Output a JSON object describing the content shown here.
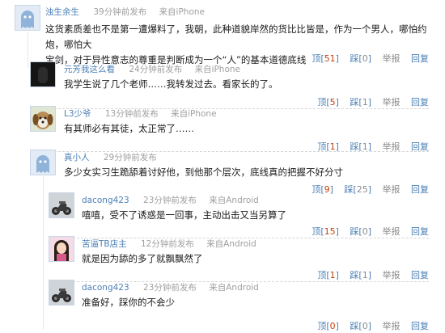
{
  "comments": [
    {
      "user": "浊生余生",
      "time": "39分钟前发布",
      "source": "来自iPhone",
      "text_lines": [
        "这货素质差也不是第一遭爆料了，我朝，此种道貌岸然的货比比皆是，作为一个男人，哪怕约炮，哪怕大",
        "宝剑，对于异性意志的尊重是判断成为一个“人”的基本道德底线"
      ],
      "top_count": "51",
      "down_count": "0"
    },
    {
      "user": "元芳我这么看",
      "time": "24分钟前发布",
      "source": "来自iPhone",
      "text_lines": [
        "我学生说了几个老师……我转发过去。看家长的了。"
      ],
      "top_count": "5",
      "down_count": "1"
    },
    {
      "user": "L3少爷",
      "time": "13分钟前发布",
      "source": "来自iPhone",
      "text_lines": [
        "有其师必有其徒，太正常了……"
      ],
      "top_count": "1",
      "down_count": "1"
    },
    {
      "user": "真小人",
      "time": "29分钟前发布",
      "source": "",
      "text_lines": [
        "多少女实习生跪舔着讨好他，到他那个层次，底线真的把握不好分寸"
      ],
      "top_count": "9",
      "down_count": "25"
    },
    {
      "user": "dacong423",
      "time": "23分钟前发布",
      "source": "来自Android",
      "text_lines": [
        "嘻嘻，受不了诱惑是一回事，主动出击又当另算了"
      ],
      "top_count": "15",
      "down_count": "0"
    },
    {
      "user": "苦逼TB店主",
      "time": "12分钟前发布",
      "source": "来自Android",
      "text_lines": [
        "就是因为舔的多了就飘飘然了"
      ],
      "top_count": "1",
      "down_count": "1"
    },
    {
      "user": "dacong423",
      "time": "23分钟前发布",
      "source": "来自Android",
      "text_lines": [
        "准备好，踩你的不会少"
      ],
      "top_count": "0",
      "down_count": "0"
    }
  ],
  "action_labels": {
    "top": "顶",
    "down": "踩",
    "report": "举报",
    "reply": "回复"
  },
  "colors": {
    "username": "#4a7fb5",
    "meta": "#a0a0a0",
    "count": "#c2410c",
    "separator": "#d5d5d5"
  },
  "avatars": [
    "ghost-avatar",
    "dark-photo-avatar",
    "dog-photo-avatar",
    "ghost-avatar",
    "motorcycle-photo-avatar",
    "girl-photo-avatar",
    "motorcycle-photo-avatar"
  ]
}
